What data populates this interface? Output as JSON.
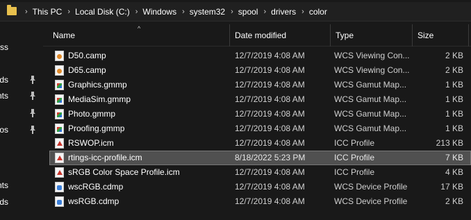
{
  "address_bar": {
    "crumbs": [
      "This PC",
      "Local Disk (C:)",
      "Windows",
      "system32",
      "spool",
      "drivers",
      "color"
    ],
    "separator": "›"
  },
  "nav_pane": {
    "items": [
      {
        "label": "ess",
        "pinned": false
      },
      {
        "label": "ds",
        "pinned": true
      },
      {
        "label": "nts",
        "pinned": true
      },
      {
        "label": "",
        "pinned": true
      },
      {
        "label": "hotos",
        "pinned": true
      },
      {
        "label": "nts",
        "pinned": false
      },
      {
        "label": "ds",
        "pinned": false
      }
    ]
  },
  "columns": {
    "name": "Name",
    "date": "Date modified",
    "type": "Type",
    "size": "Size",
    "sort_indicator": "^"
  },
  "files": [
    {
      "name": "D50.camp",
      "date": "12/7/2019 4:08 AM",
      "type": "WCS Viewing Con...",
      "size": "2 KB",
      "icon": "camp-file-icon"
    },
    {
      "name": "D65.camp",
      "date": "12/7/2019 4:08 AM",
      "type": "WCS Viewing Con...",
      "size": "2 KB",
      "icon": "camp-file-icon"
    },
    {
      "name": "Graphics.gmmp",
      "date": "12/7/2019 4:08 AM",
      "type": "WCS Gamut Map...",
      "size": "1 KB",
      "icon": "gmmp-file-icon"
    },
    {
      "name": "MediaSim.gmmp",
      "date": "12/7/2019 4:08 AM",
      "type": "WCS Gamut Map...",
      "size": "1 KB",
      "icon": "gmmp-file-icon"
    },
    {
      "name": "Photo.gmmp",
      "date": "12/7/2019 4:08 AM",
      "type": "WCS Gamut Map...",
      "size": "1 KB",
      "icon": "gmmp-file-icon"
    },
    {
      "name": "Proofing.gmmp",
      "date": "12/7/2019 4:08 AM",
      "type": "WCS Gamut Map...",
      "size": "1 KB",
      "icon": "gmmp-file-icon"
    },
    {
      "name": "RSWOP.icm",
      "date": "12/7/2019 4:08 AM",
      "type": "ICC Profile",
      "size": "213 KB",
      "icon": "icm-file-icon"
    },
    {
      "name": "rtings-icc-profile.icm",
      "date": "8/18/2022 5:23 PM",
      "type": "ICC Profile",
      "size": "7 KB",
      "icon": "icm-file-icon",
      "selected": true
    },
    {
      "name": "sRGB Color Space Profile.icm",
      "date": "12/7/2019 4:08 AM",
      "type": "ICC Profile",
      "size": "4 KB",
      "icon": "icm-file-icon"
    },
    {
      "name": "wscRGB.cdmp",
      "date": "12/7/2019 4:08 AM",
      "type": "WCS Device Profile",
      "size": "17 KB",
      "icon": "cdmp-file-icon"
    },
    {
      "name": "wsRGB.cdmp",
      "date": "12/7/2019 4:08 AM",
      "type": "WCS Device Profile",
      "size": "2 KB",
      "icon": "cdmp-file-icon"
    }
  ],
  "colors": {
    "background": "#191919",
    "selection": "#505050",
    "folder": "#e8c04d"
  }
}
